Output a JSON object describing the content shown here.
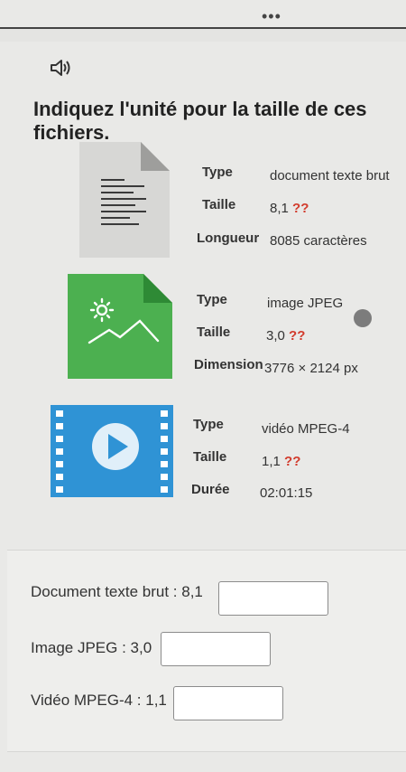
{
  "header": {
    "menu_dots": "•••"
  },
  "question": "Indiquez l'unité pour la taille de ces fichiers.",
  "files": [
    {
      "icon": "text-document-icon",
      "rows": [
        {
          "label": "Type",
          "value": "document texte brut"
        },
        {
          "label": "Taille",
          "value": "8,1 ??"
        },
        {
          "label": "Longueur",
          "value": "8085 caractères"
        }
      ]
    },
    {
      "icon": "image-file-icon",
      "rows": [
        {
          "label": "Type",
          "value": "image JPEG"
        },
        {
          "label": "Taille",
          "value": "3,0 ??"
        },
        {
          "label": "Dimension",
          "value": "3776 × 2124 px"
        }
      ]
    },
    {
      "icon": "video-file-icon",
      "rows": [
        {
          "label": "Type",
          "value": "vidéo MPEG-4"
        },
        {
          "label": "Taille",
          "value": "1,1 ??"
        },
        {
          "label": "Durée",
          "value": "02:01:15"
        }
      ]
    }
  ],
  "answers": [
    {
      "label": "Document texte brut : 8,1",
      "value": ""
    },
    {
      "label": "Image JPEG : 3,0",
      "value": ""
    },
    {
      "label": "Vidéo MPEG-4 : 1,1",
      "value": ""
    }
  ],
  "colors": {
    "image_icon_green": "#4cb050",
    "video_icon_blue": "#2f93d5",
    "question_marks_red": "#d23b2c"
  }
}
